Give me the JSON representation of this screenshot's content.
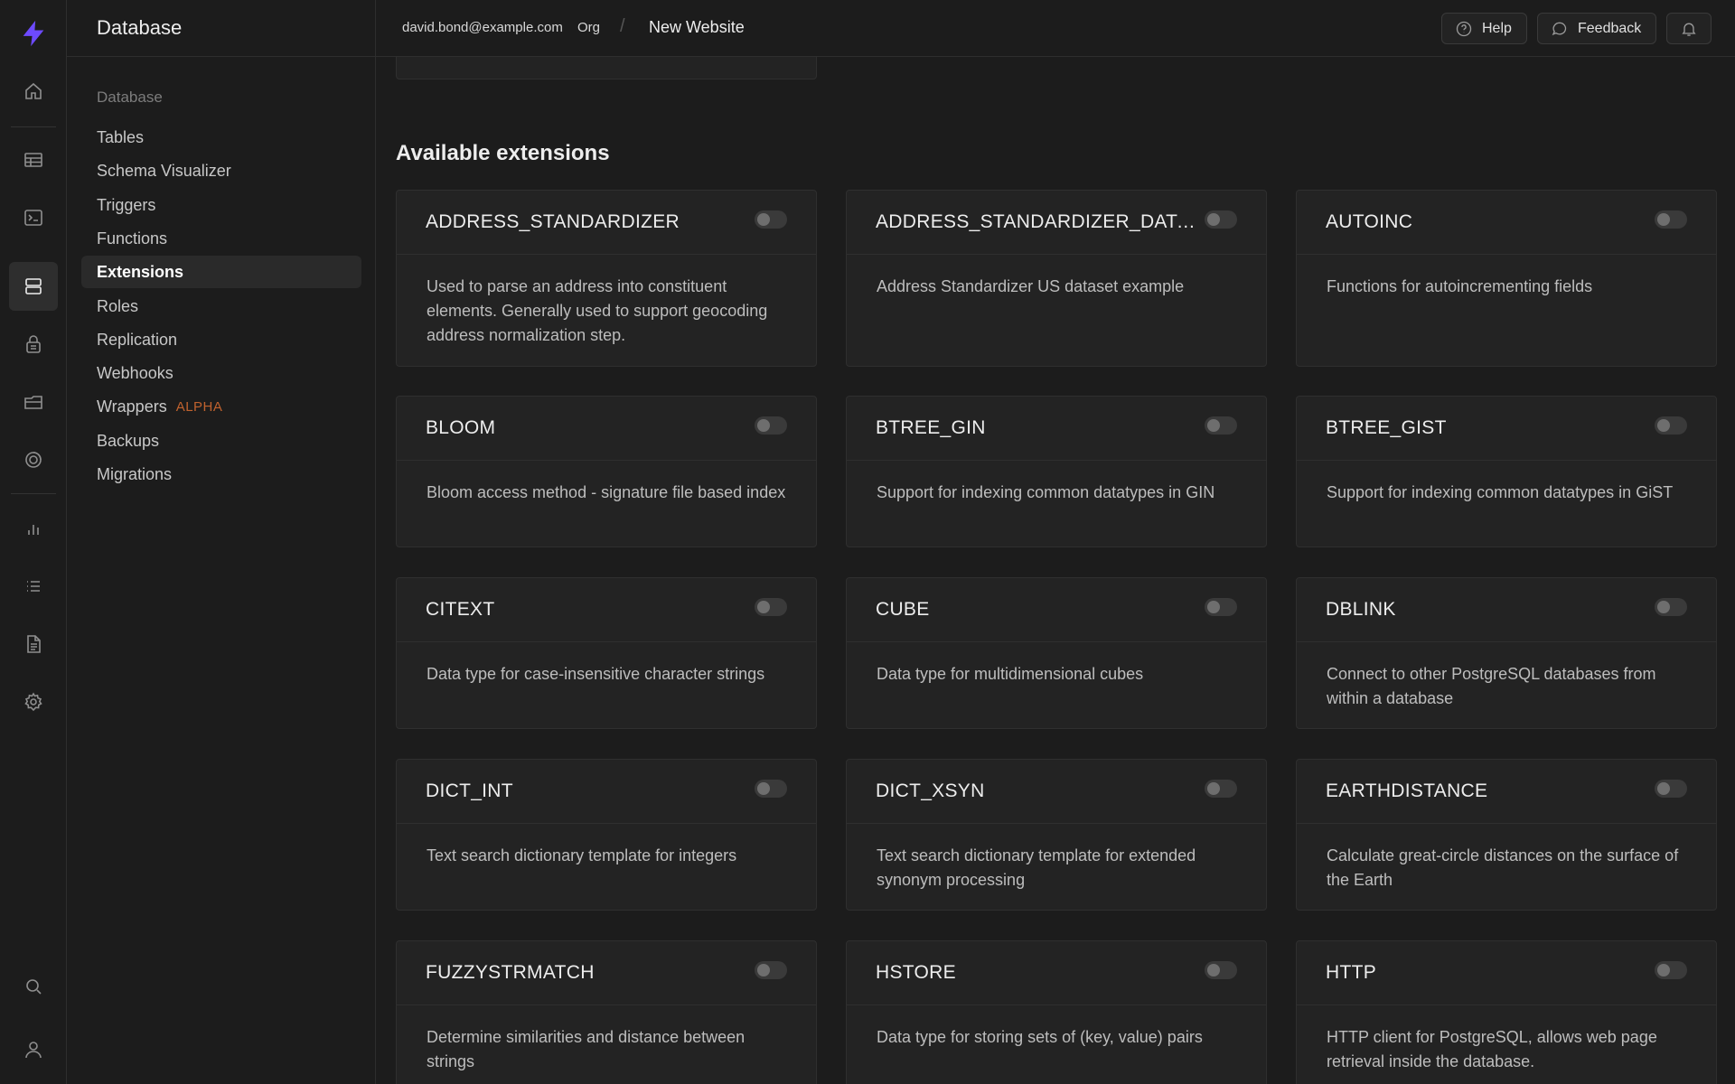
{
  "header": {
    "product_title": "Database",
    "email": "david.bond@example.com",
    "org": "Org",
    "separator": "/",
    "project": "New Website",
    "help_label": "Help",
    "feedback_label": "Feedback"
  },
  "menu": {
    "section": "Database",
    "items": [
      {
        "label": "Tables"
      },
      {
        "label": "Schema Visualizer"
      },
      {
        "label": "Triggers"
      },
      {
        "label": "Functions"
      },
      {
        "label": "Extensions",
        "active": true
      },
      {
        "label": "Roles"
      },
      {
        "label": "Replication"
      },
      {
        "label": "Webhooks"
      },
      {
        "label": "Wrappers",
        "badge": "ALPHA"
      },
      {
        "label": "Backups"
      },
      {
        "label": "Migrations"
      }
    ]
  },
  "main": {
    "section_title": "Available extensions",
    "extensions": [
      {
        "name": "ADDRESS_STANDARDIZER",
        "description": "Used to parse an address into constituent elements. Generally used to support geocoding address normalization step.",
        "enabled": false
      },
      {
        "name": "ADDRESS_STANDARDIZER_DATA_US",
        "description": "Address Standardizer US dataset example",
        "enabled": false
      },
      {
        "name": "AUTOINC",
        "description": "Functions for autoincrementing fields",
        "enabled": false
      },
      {
        "name": "BLOOM",
        "description": "Bloom access method - signature file based index",
        "enabled": false
      },
      {
        "name": "BTREE_GIN",
        "description": "Support for indexing common datatypes in GIN",
        "enabled": false
      },
      {
        "name": "BTREE_GIST",
        "description": "Support for indexing common datatypes in GiST",
        "enabled": false
      },
      {
        "name": "CITEXT",
        "description": "Data type for case-insensitive character strings",
        "enabled": false
      },
      {
        "name": "CUBE",
        "description": "Data type for multidimensional cubes",
        "enabled": false
      },
      {
        "name": "DBLINK",
        "description": "Connect to other PostgreSQL databases from within a database",
        "enabled": false
      },
      {
        "name": "DICT_INT",
        "description": "Text search dictionary template for integers",
        "enabled": false
      },
      {
        "name": "DICT_XSYN",
        "description": "Text search dictionary template for extended synonym processing",
        "enabled": false
      },
      {
        "name": "EARTHDISTANCE",
        "description": "Calculate great-circle distances on the surface of the Earth",
        "enabled": false
      },
      {
        "name": "FUZZYSTRMATCH",
        "description": "Determine similarities and distance between strings",
        "enabled": false
      },
      {
        "name": "HSTORE",
        "description": "Data type for storing sets of (key, value) pairs",
        "enabled": false
      },
      {
        "name": "HTTP",
        "description": "HTTP client for PostgreSQL, allows web page retrieval inside the database.",
        "enabled": false
      }
    ]
  },
  "colors": {
    "accent": "#6d4aff",
    "alpha_badge": "#c0622e",
    "background": "#1c1c1c",
    "card": "#232323"
  },
  "icons": {
    "rail": [
      "logo-icon",
      "home-icon",
      "table-editor-icon",
      "sql-editor-icon",
      "database-icon",
      "authentication-icon",
      "storage-icon",
      "realtime-icon",
      "reports-icon",
      "logs-icon",
      "api-docs-icon",
      "settings-icon",
      "search-icon",
      "user-icon"
    ],
    "topbar": [
      "help-icon",
      "feedback-icon",
      "bell-icon"
    ]
  }
}
